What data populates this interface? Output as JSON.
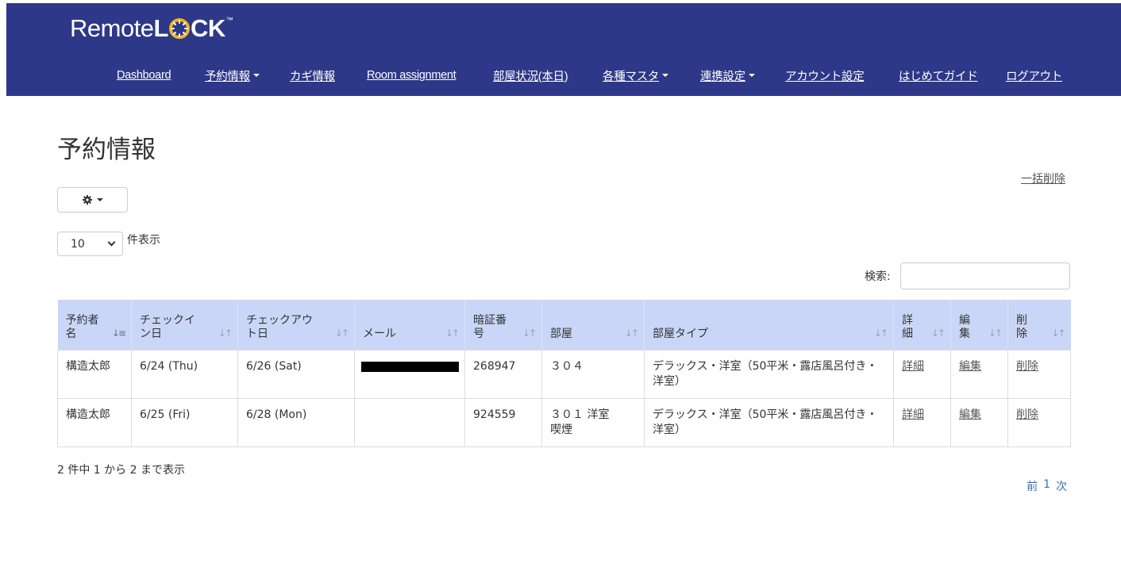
{
  "brand": {
    "logo_prefix": "Remote",
    "logo_l": "L",
    "logo_suffix": "CK",
    "logo_tm": "™"
  },
  "nav": {
    "items": [
      {
        "label": "Dashboard",
        "dropdown": false
      },
      {
        "label": "予約情報",
        "dropdown": true
      },
      {
        "label": "カギ情報",
        "dropdown": false
      },
      {
        "label": "Room assignment",
        "dropdown": false
      },
      {
        "label": "部屋状況(本日)",
        "dropdown": false
      },
      {
        "label": "各種マスタ",
        "dropdown": true
      },
      {
        "label": "連携設定",
        "dropdown": true
      },
      {
        "label": "アカウント設定",
        "dropdown": false
      },
      {
        "label": "はじめてガイド",
        "dropdown": false
      },
      {
        "label": "ログアウト",
        "dropdown": false
      }
    ]
  },
  "page": {
    "title": "予約情報",
    "bulk_delete": "一括削除"
  },
  "toolbar": {
    "gear_icon": "gear-icon"
  },
  "length": {
    "value": "10",
    "label": "件表示"
  },
  "search": {
    "label": "検索:",
    "value": "",
    "placeholder": ""
  },
  "table": {
    "headers": [
      {
        "line1": "予約者",
        "line2": "名"
      },
      {
        "line1": "チェックイ",
        "line2": "ン日"
      },
      {
        "line1": "チェックアウ",
        "line2": "ト日"
      },
      {
        "line1": "",
        "line2": "メール"
      },
      {
        "line1": "暗証番",
        "line2": "号"
      },
      {
        "line1": "",
        "line2": "部屋"
      },
      {
        "line1": "",
        "line2": "部屋タイプ"
      },
      {
        "line1": "詳",
        "line2": "細"
      },
      {
        "line1": "編",
        "line2": "集"
      },
      {
        "line1": "削",
        "line2": "除"
      }
    ],
    "rows": [
      {
        "name": "構造太郎",
        "checkin": "6/24 (Thu)",
        "checkout": "6/26 (Sat)",
        "email_redacted": true,
        "pin": "268947",
        "room_line1": "３０４",
        "room_line2": "",
        "room_type": "デラックス・洋室（50平米・露店風呂付き・洋室）",
        "detail": "詳細",
        "edit": "編集",
        "delete": "削除"
      },
      {
        "name": "構造太郎",
        "checkin": "6/25 (Fri)",
        "checkout": "6/28 (Mon)",
        "email_redacted": false,
        "pin": "924559",
        "room_line1": "３０１ 洋室",
        "room_line2": "喫煙",
        "room_type": "デラックス・洋室（50平米・露店風呂付き・洋室）",
        "detail": "詳細",
        "edit": "編集",
        "delete": "削除"
      }
    ]
  },
  "footer": {
    "info": "2 件中 1 から 2 まで表示",
    "prev": "前",
    "current": "1",
    "next": "次"
  },
  "colors": {
    "topbar": "#2e3888",
    "table_header": "#c9d6f7",
    "pager_link": "#3a6fb0"
  }
}
